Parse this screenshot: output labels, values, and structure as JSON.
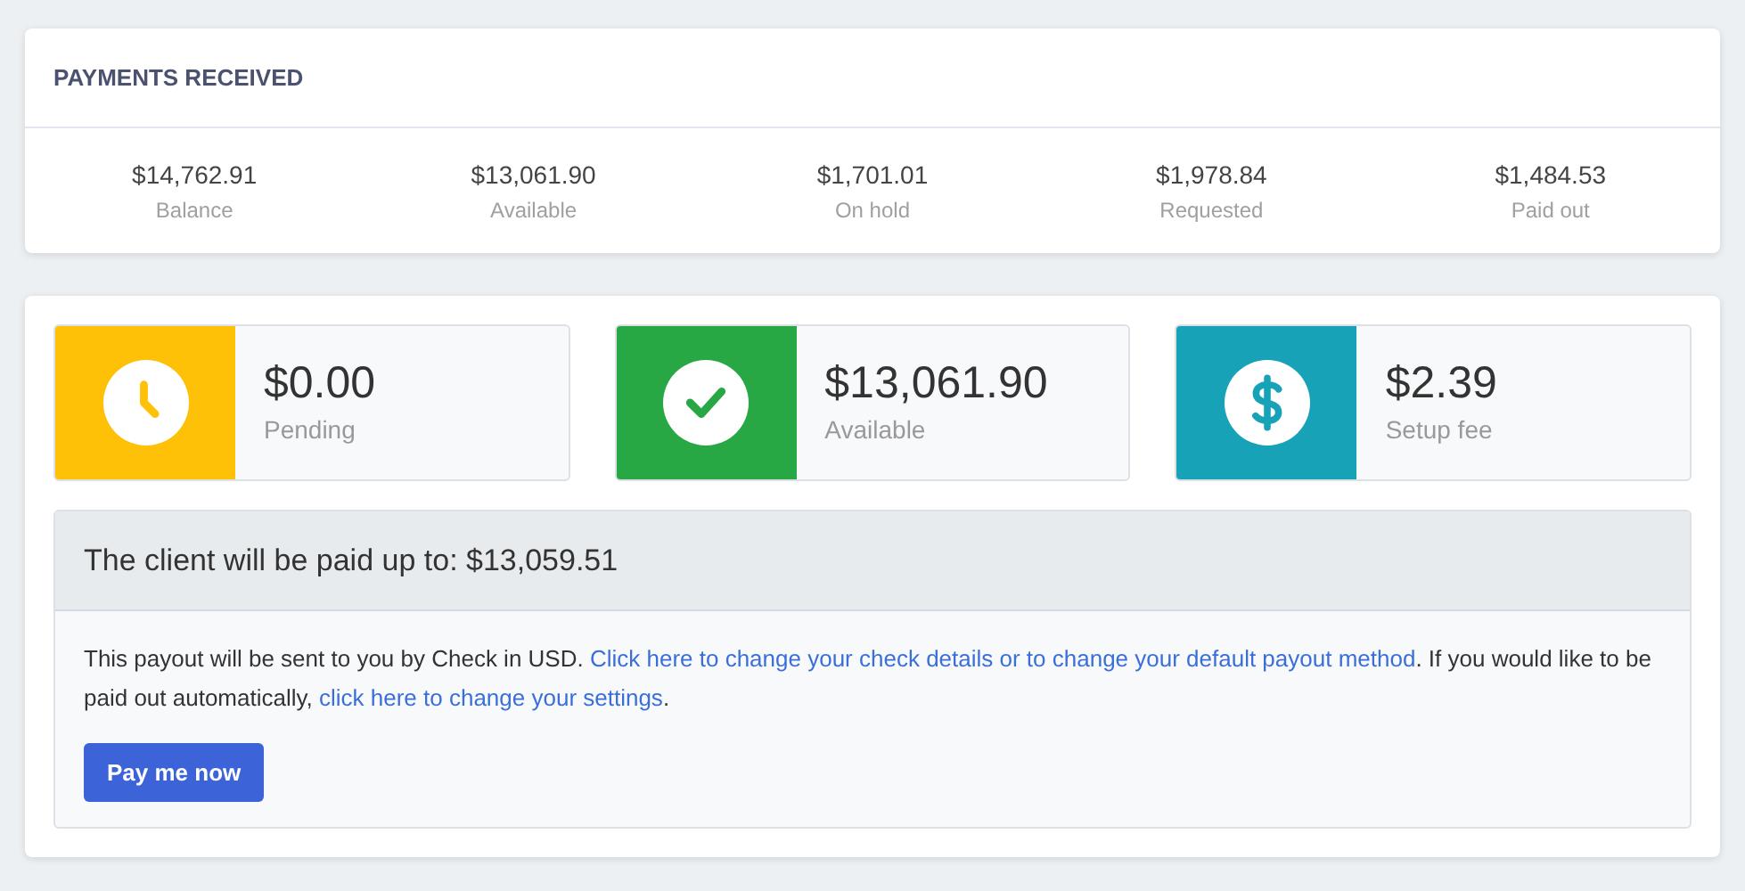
{
  "payments_received": {
    "title": "PAYMENTS RECEIVED",
    "stats": [
      {
        "value": "$14,762.91",
        "label": "Balance"
      },
      {
        "value": "$13,061.90",
        "label": "Available"
      },
      {
        "value": "$1,701.01",
        "label": "On hold"
      },
      {
        "value": "$1,978.84",
        "label": "Requested"
      },
      {
        "value": "$1,484.53",
        "label": "Paid out"
      }
    ]
  },
  "summary_cards": [
    {
      "kind": "clock",
      "color": "#ffc107",
      "value": "$0.00",
      "label": "Pending"
    },
    {
      "kind": "check",
      "color": "#28a745",
      "value": "$13,061.90",
      "label": "Available"
    },
    {
      "kind": "dollar",
      "color": "#17a2b8",
      "value": "$2.39",
      "label": "Setup fee"
    }
  ],
  "payout": {
    "heading": "The client will be paid up to: $13,059.51",
    "note": [
      {
        "kind": "text",
        "text": "This payout will be sent to you by Check in USD. "
      },
      {
        "kind": "link",
        "text": "Click here to change your check details or to change your default payout method"
      },
      {
        "kind": "text",
        "text": ". If you would like to be paid out automatically, "
      },
      {
        "kind": "link",
        "text": "click here to change your settings"
      },
      {
        "kind": "text",
        "text": "."
      }
    ],
    "button": "Pay me now"
  }
}
